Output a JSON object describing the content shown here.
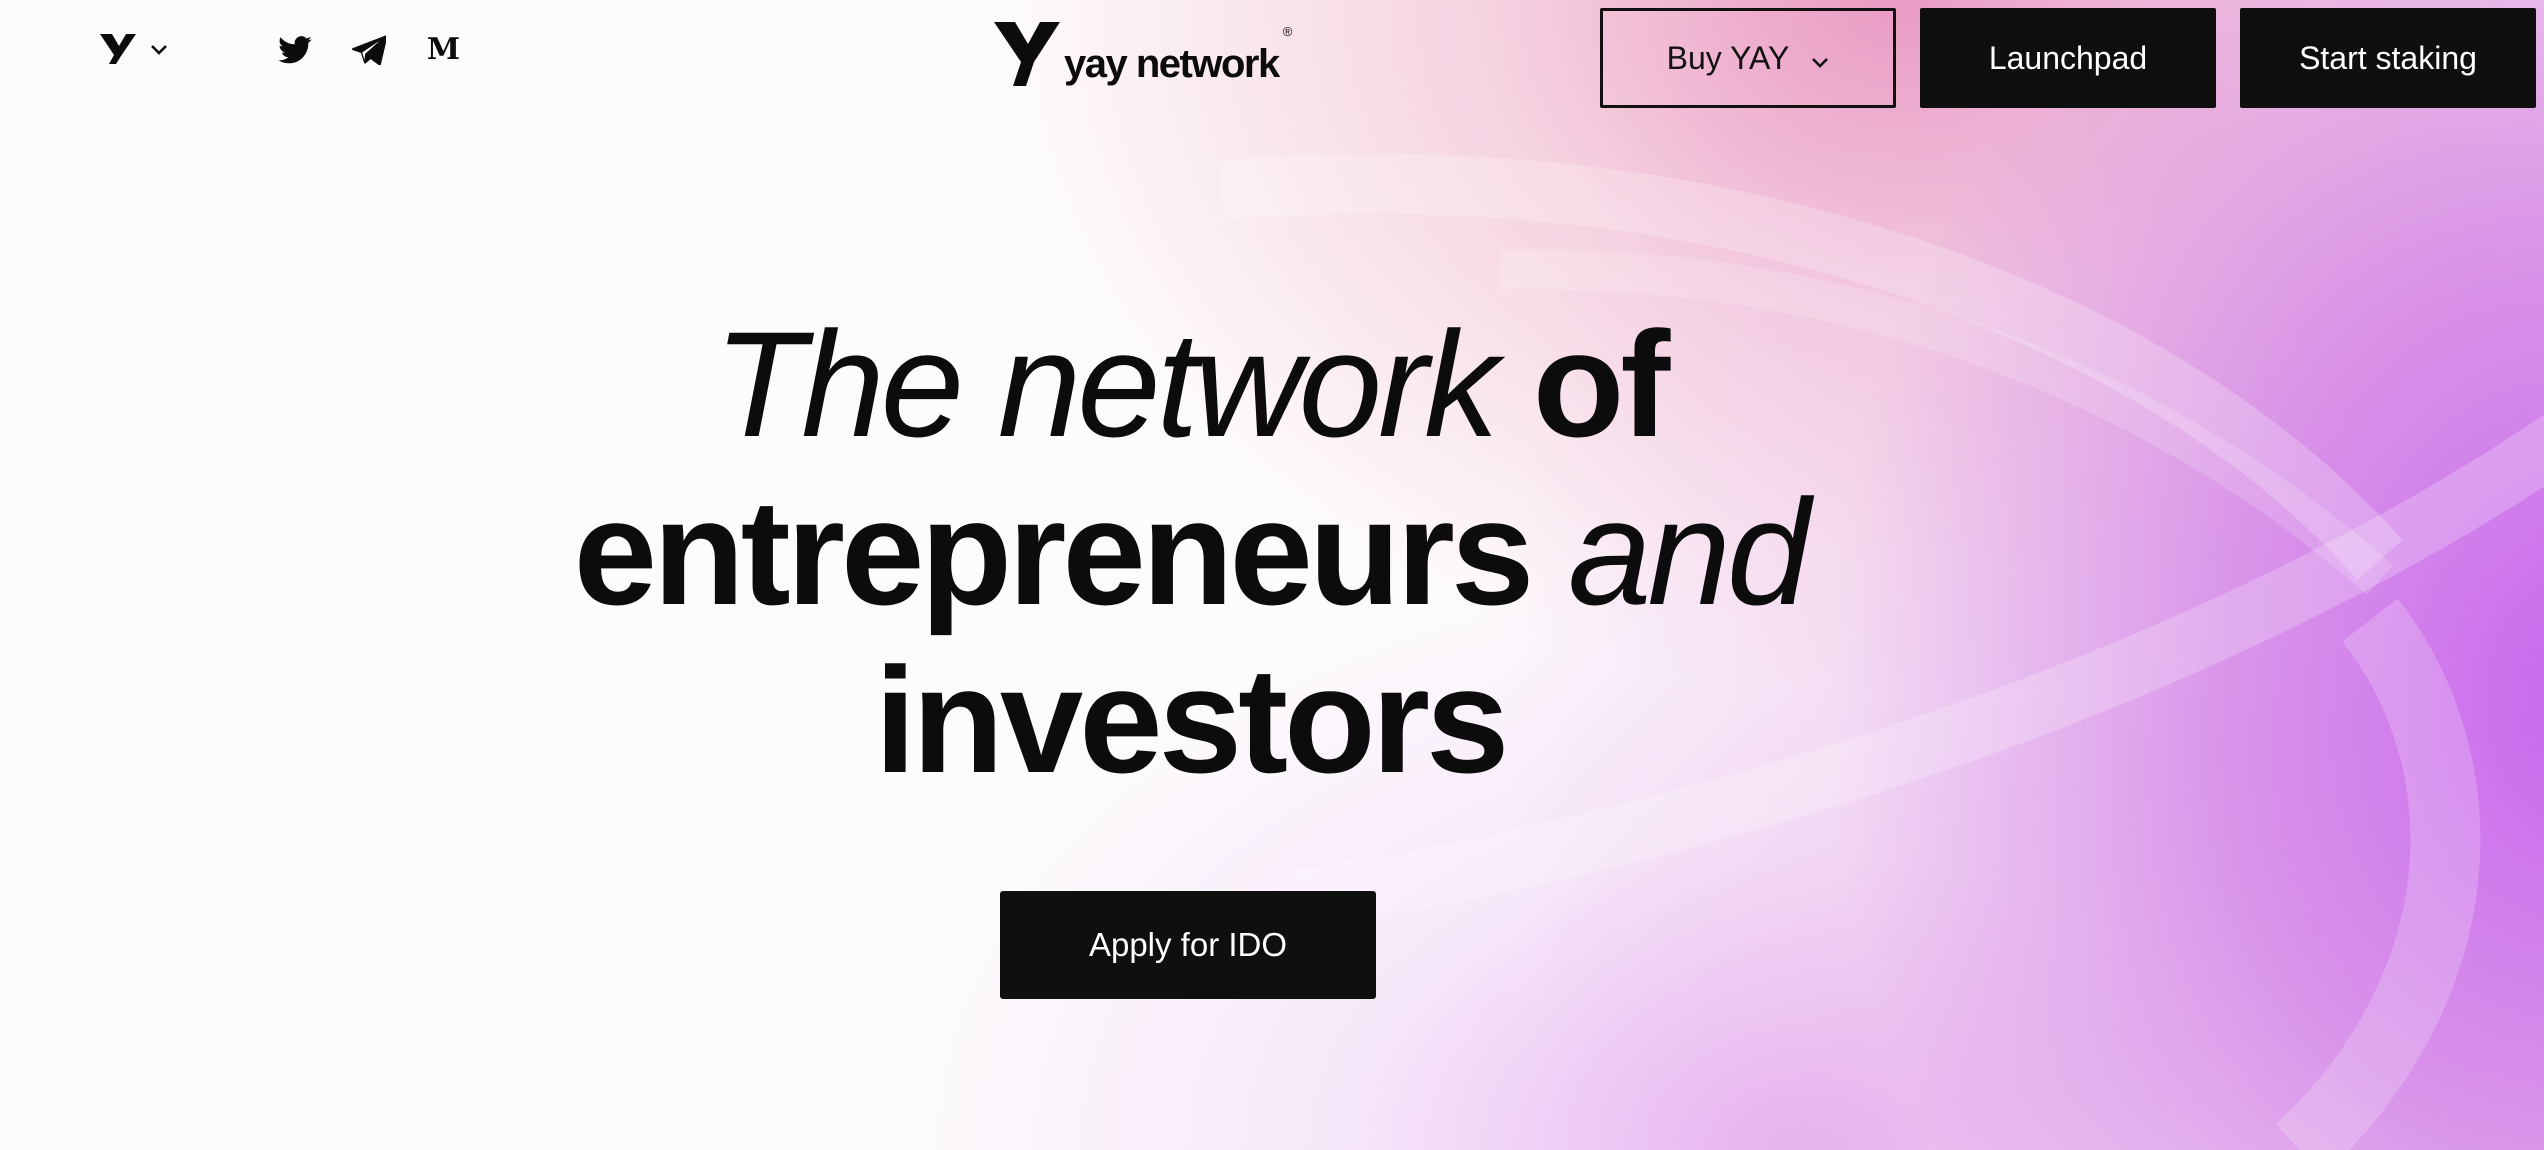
{
  "header": {
    "logo_menu": {
      "icon": "yay-logo-icon",
      "chevron": "chevron-down-icon"
    },
    "socials": [
      {
        "name": "twitter",
        "icon": "twitter-icon"
      },
      {
        "name": "telegram",
        "icon": "telegram-icon"
      },
      {
        "name": "medium",
        "icon": "medium-icon",
        "glyph": "M"
      }
    ],
    "brand": {
      "name": "yay network",
      "reg": "®"
    },
    "buttons": {
      "buy": "Buy YAY",
      "launchpad": "Launchpad",
      "staking": "Start staking"
    }
  },
  "hero": {
    "line1_italic": "The network",
    "line1_plain": "of",
    "line2_plain": "entrepreneurs",
    "line2_italic": "and",
    "line3_plain": "investors",
    "cta": "Apply for IDO"
  },
  "colors": {
    "accent_purple": "#c45cec",
    "accent_pink": "#e478aa",
    "dark": "#0f0f0f",
    "background": "#fdfbfd"
  }
}
